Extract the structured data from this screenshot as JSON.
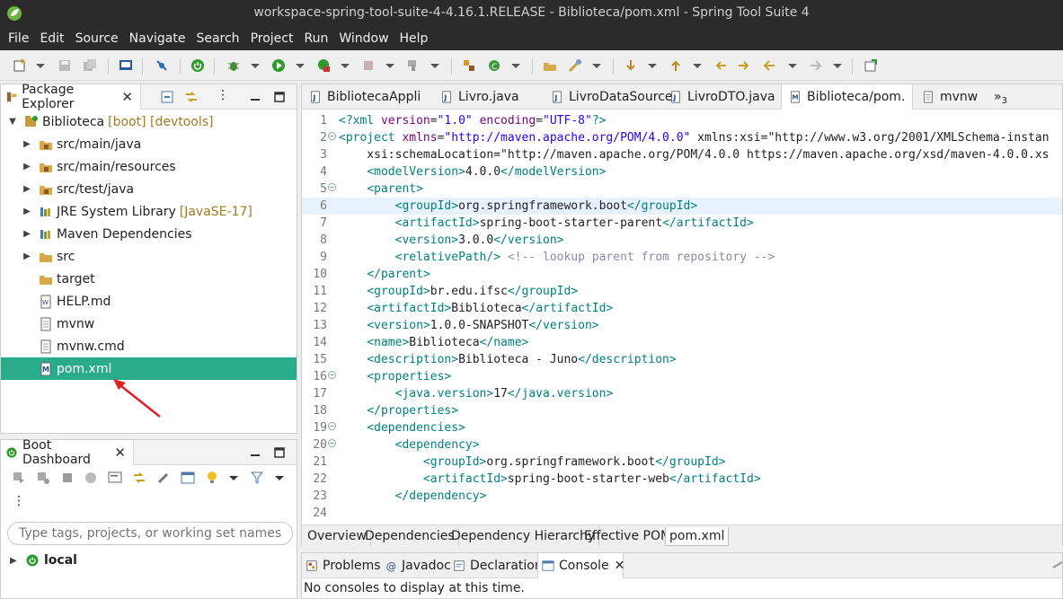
{
  "window": {
    "title": "workspace-spring-tool-suite-4-4.16.1.RELEASE - Biblioteca/pom.xml - Spring Tool Suite 4"
  },
  "menu": [
    "File",
    "Edit",
    "Source",
    "Navigate",
    "Search",
    "Project",
    "Run",
    "Window",
    "Help"
  ],
  "package_explorer": {
    "tab_label": "Package Explorer",
    "tree": [
      {
        "label": "Biblioteca",
        "decor": "[boot] [devtools]",
        "icon": "project-icon",
        "expanded": true
      },
      {
        "label": "src/main/java",
        "icon": "source-folder-icon"
      },
      {
        "label": "src/main/resources",
        "icon": "source-folder-icon"
      },
      {
        "label": "src/test/java",
        "icon": "source-folder-icon"
      },
      {
        "label": "JRE System Library",
        "decor": "[JavaSE-17]",
        "icon": "library-icon"
      },
      {
        "label": "Maven Dependencies",
        "icon": "library-icon"
      },
      {
        "label": "src",
        "icon": "folder-icon"
      },
      {
        "label": "target",
        "icon": "folder-icon"
      },
      {
        "label": "HELP.md",
        "icon": "markdown-file-icon"
      },
      {
        "label": "mvnw",
        "icon": "file-icon"
      },
      {
        "label": "mvnw.cmd",
        "icon": "file-icon"
      },
      {
        "label": "pom.xml",
        "icon": "maven-file-icon",
        "selected": true
      }
    ]
  },
  "boot_dashboard": {
    "tab_label": "Boot Dashboard",
    "search_placeholder": "Type tags, projects, or working set names to ...",
    "local_label": "local"
  },
  "editor": {
    "tabs": [
      {
        "label": "BibliotecaAppli",
        "icon": "java-file-icon"
      },
      {
        "label": "Livro.java",
        "icon": "java-file-icon"
      },
      {
        "label": "LivroDataSource",
        "icon": "java-file-icon"
      },
      {
        "label": "LivroDTO.java",
        "icon": "java-file-icon"
      },
      {
        "label": "Biblioteca/pom.",
        "icon": "maven-file-icon",
        "active": true
      },
      {
        "label": "mvnw",
        "icon": "file-icon"
      }
    ],
    "overflow_label": "»",
    "overflow_count": "3",
    "code_lines": [
      "<?xml version=\"1.0\" encoding=\"UTF-8\"?>",
      "<project xmlns=\"http://maven.apache.org/POM/4.0.0\" xmlns:xsi=\"http://www.w3.org/2001/XMLSchema-instan",
      "    xsi:schemaLocation=\"http://maven.apache.org/POM/4.0.0 https://maven.apache.org/xsd/maven-4.0.0.xs",
      "    <modelVersion>4.0.0</modelVersion>",
      "    <parent>",
      "        <groupId>org.springframework.boot</groupId>",
      "        <artifactId>spring-boot-starter-parent</artifactId>",
      "        <version>3.0.0</version>",
      "        <relativePath/> <!-- lookup parent from repository -->",
      "    </parent>",
      "    <groupId>br.edu.ifsc</groupId>",
      "    <artifactId>Biblioteca</artifactId>",
      "    <version>1.0.0-SNAPSHOT</version>",
      "    <name>Biblioteca</name>",
      "    <description>Biblioteca - Juno</description>",
      "    <properties>",
      "        <java.version>17</java.version>",
      "    </properties>",
      "    <dependencies>",
      "        <dependency>",
      "            <groupId>org.springframework.boot</groupId>",
      "            <artifactId>spring-boot-starter-web</artifactId>",
      "        </dependency>",
      ""
    ],
    "fold_lines": [
      2,
      5,
      16,
      19,
      20
    ],
    "current_line": 6,
    "bottom_tabs": [
      "Overview",
      "Dependencies",
      "Dependency Hierarchy",
      "Effective POM",
      "pom.xml"
    ],
    "bottom_active": "pom.xml"
  },
  "console": {
    "tabs": [
      {
        "label": "Problems",
        "icon": "problems-icon"
      },
      {
        "label": "Javadoc",
        "icon": "javadoc-icon"
      },
      {
        "label": "Declaration",
        "icon": "declaration-icon"
      },
      {
        "label": "Console",
        "icon": "console-icon",
        "active": true
      }
    ],
    "message": "No consoles to display at this time."
  },
  "colors": {
    "selection": "#2aab8a",
    "accent": "#6db33f",
    "annotation_arrow": "#e02020"
  }
}
